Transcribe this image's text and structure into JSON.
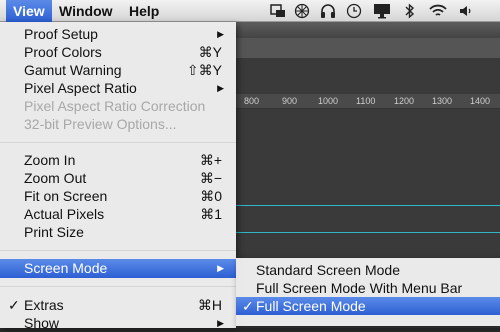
{
  "menubar": {
    "items": [
      "View",
      "Window",
      "Help"
    ]
  },
  "status_icons": [
    "server-icon",
    "pinwheel-icon",
    "headphones-icon",
    "time-machine-icon",
    "display-icon",
    "bluetooth-icon",
    "wifi-icon",
    "volume-icon"
  ],
  "view_menu": {
    "items": [
      {
        "label": "Proof Setup",
        "arrow": "▶"
      },
      {
        "label": "Proof Colors",
        "shortcut": "⌘Y"
      },
      {
        "label": "Gamut Warning",
        "shortcut": "⇧⌘Y"
      },
      {
        "label": "Pixel Aspect Ratio",
        "arrow": "▶"
      },
      {
        "label": "Pixel Aspect Ratio Correction"
      },
      {
        "label": "32-bit Preview Options..."
      },
      {
        "label": "Zoom In",
        "shortcut": "⌘+"
      },
      {
        "label": "Zoom Out",
        "shortcut": "⌘−"
      },
      {
        "label": "Fit on Screen",
        "shortcut": "⌘0"
      },
      {
        "label": "Actual Pixels",
        "shortcut": "⌘1"
      },
      {
        "label": "Print Size"
      },
      {
        "label": "Screen Mode",
        "arrow": "▶"
      },
      {
        "label": "Extras",
        "shortcut": "⌘H",
        "check": "✓"
      },
      {
        "label": "Show",
        "arrow": "▶"
      }
    ]
  },
  "screen_mode_submenu": {
    "items": [
      {
        "label": "Standard Screen Mode"
      },
      {
        "label": "Full Screen Mode With Menu Bar"
      },
      {
        "label": "Full Screen Mode",
        "check": "✓"
      }
    ]
  },
  "ruler_ticks": [
    "800",
    "900",
    "1000",
    "1100",
    "1200",
    "1300",
    "1400"
  ],
  "colors": {
    "highlight": "#3d6fdc",
    "guide": "#2fb6c8"
  }
}
